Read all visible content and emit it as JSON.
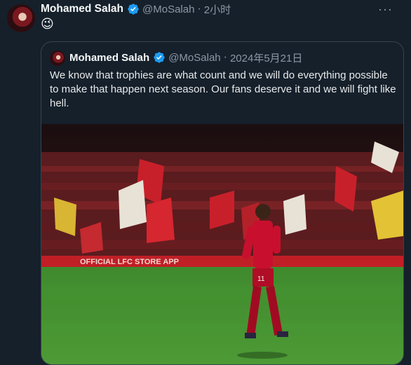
{
  "tweet": {
    "author_name": "Mohamed Salah",
    "handle": "@MoSalah",
    "separator": "·",
    "time": "2小时",
    "more_label": "···",
    "body_emoji": "😉"
  },
  "quoted_tweet": {
    "author_name": "Mohamed Salah",
    "handle": "@MoSalah",
    "separator": "·",
    "date": "2024年5月21日",
    "text": "We know that trophies are what count and we will do everything possible to make that happen next season. Our fans deserve it and we will fight like hell."
  },
  "media": {
    "description_icon": "photo-stadium",
    "hoarding_text": "OFFICIAL LFC STORE APP",
    "shirt_number": "11"
  },
  "colors": {
    "background": "#15202b",
    "verified_blue": "#1d9bf0",
    "muted_text": "#8b98a5",
    "border": "#38444d"
  }
}
